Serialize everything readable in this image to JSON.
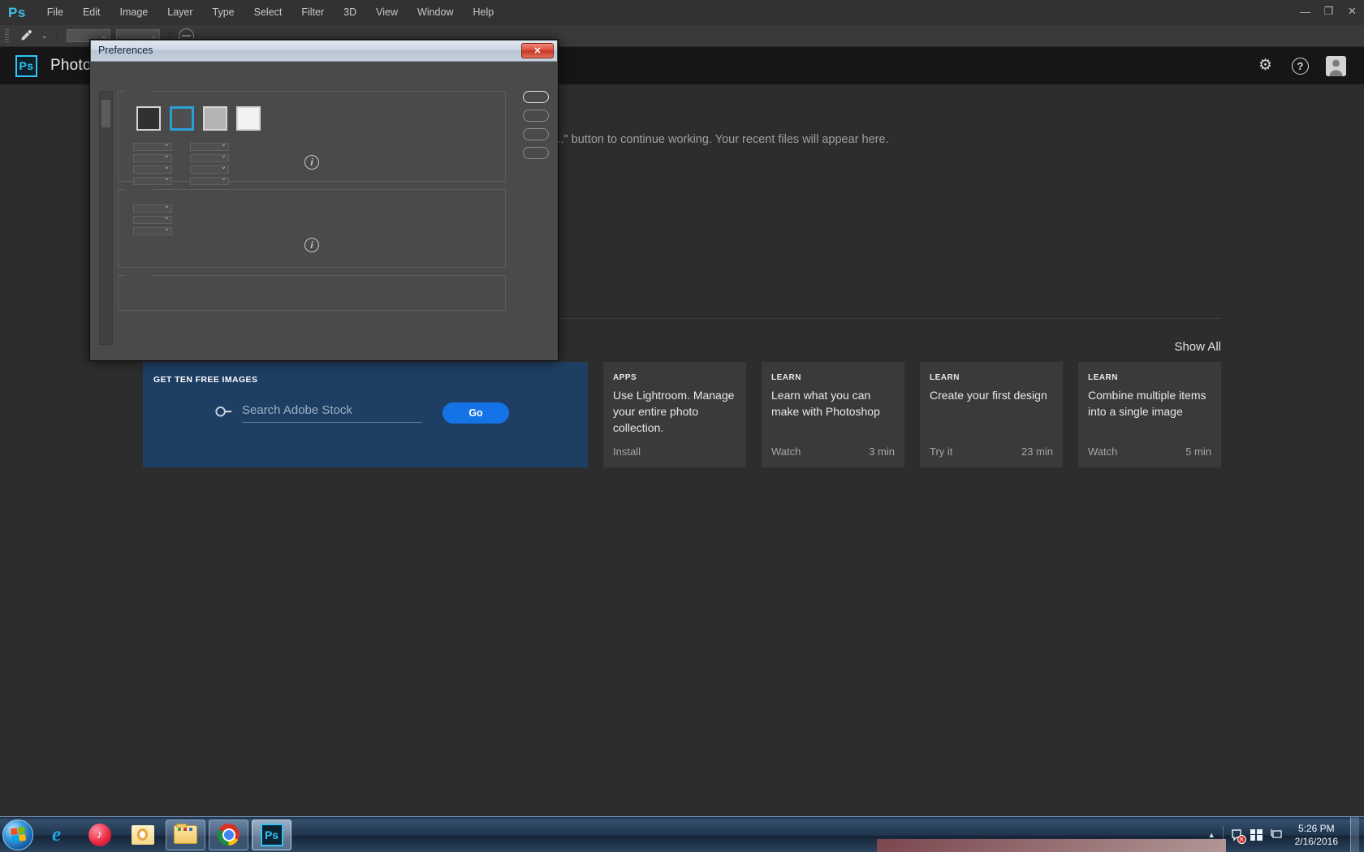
{
  "menubar": {
    "logo": "Ps",
    "items": [
      "File",
      "Edit",
      "Image",
      "Layer",
      "Type",
      "Select",
      "Filter",
      "3D",
      "View",
      "Window",
      "Help"
    ],
    "window_controls": {
      "minimize": "—",
      "restore": "❐",
      "close": "✕"
    }
  },
  "optionsbar": {
    "tool_icon": "eyedropper-icon",
    "tool_glyph": "⟋",
    "caret": "⌄"
  },
  "header": {
    "badge": "Ps",
    "title": "Photoshop",
    "gear_glyph": "⚙",
    "help_glyph": "?"
  },
  "start_screen": {
    "recent_message": "click the \"Open...\" button to continue working. Your recent files will appear here.",
    "show_all": "Show All"
  },
  "stock": {
    "label": "GET TEN FREE IMAGES",
    "search_placeholder": "Search Adobe Stock",
    "search_value": "",
    "go_label": "Go",
    "accent": "#1473e6",
    "panel_bg": "#1f3e63"
  },
  "cards": [
    {
      "kicker": "APPS",
      "title": "Use Lightroom. Manage your entire photo collection.",
      "action": "Install",
      "duration": ""
    },
    {
      "kicker": "LEARN",
      "title": "Learn what you can make with Photoshop",
      "action": "Watch",
      "duration": "3 min"
    },
    {
      "kicker": "LEARN",
      "title": "Create your first design",
      "action": "Try it",
      "duration": "23 min"
    },
    {
      "kicker": "LEARN",
      "title": "Combine multiple items into a single image",
      "action": "Watch",
      "duration": "5 min"
    }
  ],
  "preferences_dialog": {
    "title": "Preferences",
    "close_label": "✕",
    "selected_theme_index": 1,
    "theme_swatches": [
      "#313131",
      "#4f4f4f",
      "#b4b4b4",
      "#f2f2f2"
    ],
    "selection_color": "#2a9fd8",
    "info_glyph": "i",
    "button_count": 4,
    "primary_button_index": 0
  },
  "taskbar": {
    "items": [
      {
        "name": "start-orb",
        "label": ""
      },
      {
        "name": "internet-explorer",
        "label": "e"
      },
      {
        "name": "itunes",
        "label": "♪"
      },
      {
        "name": "outlook",
        "label": ""
      },
      {
        "name": "windows-explorer",
        "label": ""
      },
      {
        "name": "google-chrome",
        "label": ""
      },
      {
        "name": "photoshop",
        "label": "Ps"
      }
    ],
    "tray_arrow": "▲",
    "time": "5:26 PM",
    "date": "2/16/2016"
  }
}
